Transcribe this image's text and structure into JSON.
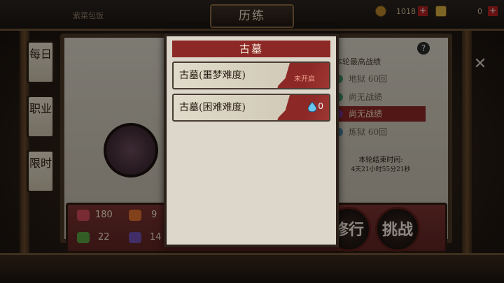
{
  "header": {
    "title": "历练",
    "player_name": "紫菜包饭"
  },
  "resources": [
    {
      "name": "copper-coin",
      "value": "1018"
    },
    {
      "name": "gold-ingot",
      "value": "0"
    }
  ],
  "side_tabs": [
    {
      "label": "每日"
    },
    {
      "label": "职业"
    },
    {
      "label": "限时"
    }
  ],
  "ranking": {
    "header": "本轮最高战绩",
    "items": [
      "地狱 60回",
      "尚无战绩",
      "尚无战绩",
      "炼狱 60回"
    ],
    "end_label": "本轮结束时间:",
    "end_time": "4天21小时55分21秒"
  },
  "stats": [
    {
      "icon": "heart-icon",
      "value": "180"
    },
    {
      "icon": "flame-icon",
      "value": "9"
    },
    {
      "icon": "sword-icon",
      "value": "22"
    },
    {
      "icon": "armor-icon",
      "value": "14"
    }
  ],
  "buttons": {
    "practice": "修行",
    "challenge": "挑战"
  },
  "modal": {
    "title": "古墓",
    "entries": [
      {
        "label": "古墓(噩梦难度)",
        "status": "未开启"
      },
      {
        "label": "古墓(困难难度)",
        "reward": "0"
      }
    ]
  },
  "colors": {
    "accent_red": "#8c2926",
    "parchment": "#ddd7cb"
  }
}
